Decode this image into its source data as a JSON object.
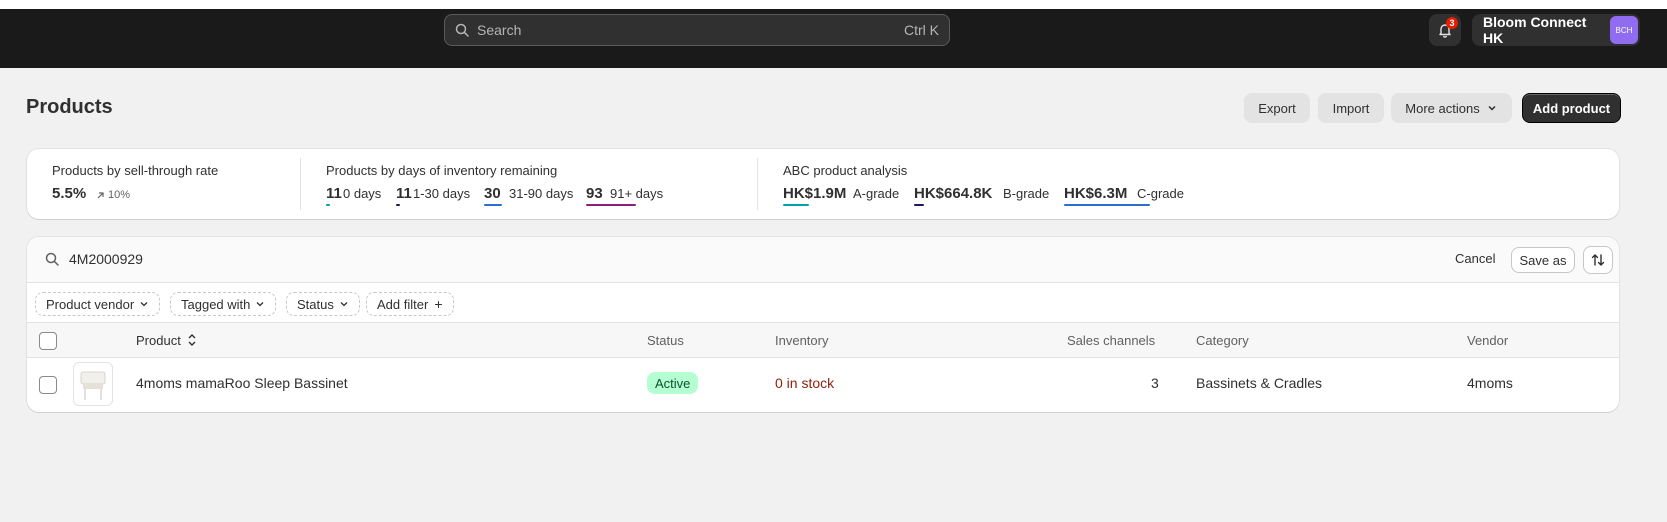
{
  "topbar": {
    "search_placeholder": "Search",
    "search_shortcut": "Ctrl K",
    "notification_count": "3",
    "store_name": "Bloom Connect HK",
    "store_initials": "BCH"
  },
  "page": {
    "title": "Products",
    "actions": {
      "export": "Export",
      "import": "Import",
      "more_actions": "More actions",
      "add_product": "Add product"
    }
  },
  "metrics": {
    "sell_through": {
      "label": "Products by sell-through rate",
      "value": "5.5%",
      "change": "10%"
    },
    "days_inventory": {
      "label": "Products by days of inventory remaining",
      "buckets": [
        {
          "count": "11",
          "label": "0 days",
          "color": "#00a0ac"
        },
        {
          "count": "11",
          "label": "1-30 days",
          "color": "#1a1a5e"
        },
        {
          "count": "30",
          "label": "31-90 days",
          "color": "#2c6ecb"
        },
        {
          "count": "93",
          "label": "91+ days",
          "color": "#8c1f7c"
        }
      ]
    },
    "abc": {
      "label": "ABC product analysis",
      "grades": [
        {
          "value": "HK$1.9M",
          "label": "A-grade",
          "color": "#00a0ac"
        },
        {
          "value": "HK$664.8K",
          "label": "B-grade",
          "color": "#1a1a5e"
        },
        {
          "value": "HK$6.3M",
          "label": "C-grade",
          "color": "#2c6ecb"
        }
      ]
    }
  },
  "filter_bar": {
    "query": "4M2000929",
    "cancel": "Cancel",
    "save_as": "Save as",
    "filters": [
      "Product vendor",
      "Tagged with",
      "Status",
      "Add filter"
    ]
  },
  "table": {
    "columns": [
      "Product",
      "Status",
      "Inventory",
      "Sales channels",
      "Category",
      "Vendor"
    ],
    "rows": [
      {
        "product": "4moms mamaRoo Sleep Bassinet",
        "status": "Active",
        "inventory": "0 in stock",
        "sales_channels": "3",
        "category": "Bassinets & Cradles",
        "vendor": "4moms"
      }
    ]
  },
  "colors": {
    "topbar": "#1a1a1a",
    "active_badge_bg": "#b4fed2",
    "active_badge_text": "#0c5132",
    "out_of_stock": "#8e1f0b"
  }
}
